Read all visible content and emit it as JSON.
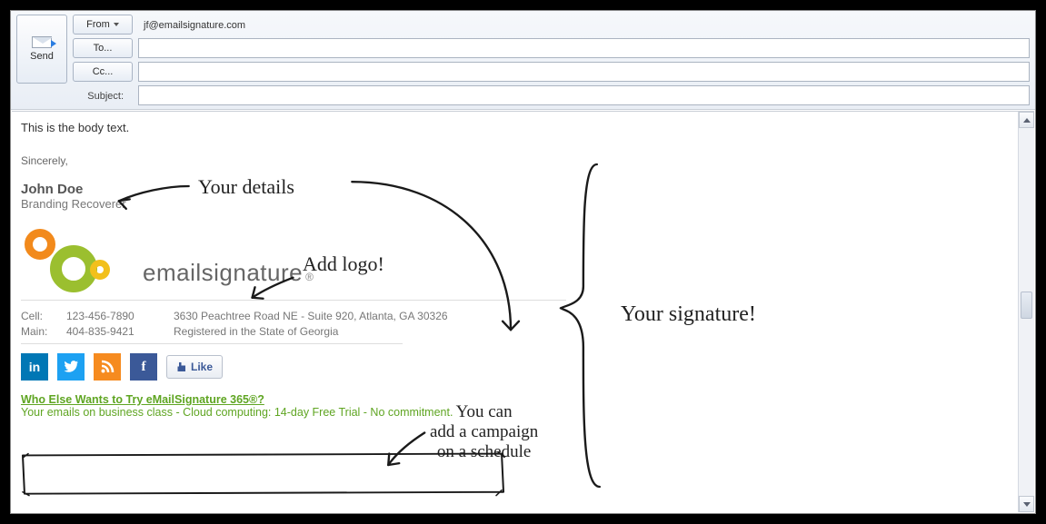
{
  "header": {
    "send_label": "Send",
    "from_label": "From",
    "to_label": "To...",
    "cc_label": "Cc...",
    "subject_label": "Subject:",
    "from_value": "jf@emailsignature.com",
    "to_value": "",
    "cc_value": "",
    "subject_value": ""
  },
  "body": {
    "text": "This is the body text.",
    "signoff": "Sincerely,"
  },
  "signature": {
    "name": "John Doe",
    "title": "Branding Recoverer",
    "brand_word": "emailsignature",
    "brand_reg": "®",
    "contact": {
      "cell_label": "Cell:",
      "cell_value": "123-456-7890",
      "main_label": "Main:",
      "main_value": "404-835-9421",
      "address": "3630 Peachtree Road NE - Suite 920, Atlanta, GA 30326",
      "registered": "Registered in the State of Georgia"
    },
    "social": {
      "linkedin": "in",
      "twitter": "t",
      "rss": "◔",
      "facebook": "f",
      "like_label": "Like"
    },
    "campaign": {
      "headline": "Who Else Wants to Try eMailSignature 365®?",
      "sub": "Your emails on business class - Cloud computing: 14-day Free Trial - No commitment."
    }
  },
  "annotations": {
    "details": "Your details",
    "logo": "Add logo!",
    "signature": "Your signature!",
    "campaign": "You can\nadd a campaign\non a schedule"
  }
}
